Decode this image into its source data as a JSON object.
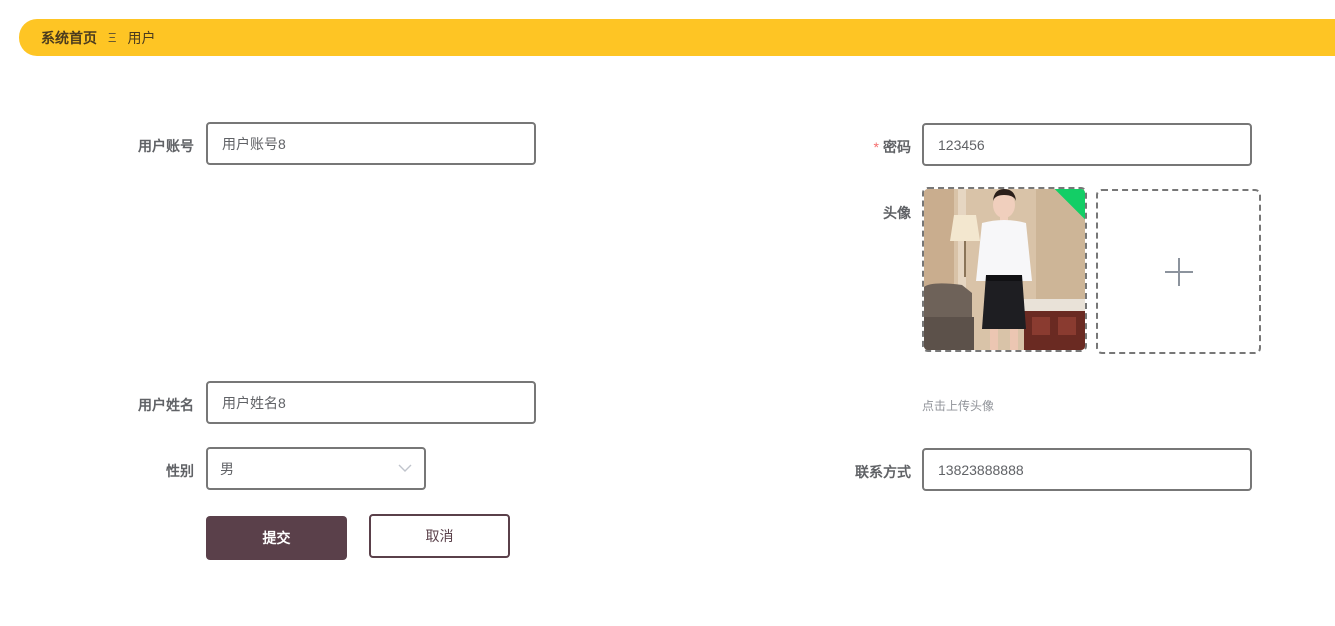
{
  "breadcrumb": {
    "home": "系统首页",
    "separator_icon": "menu-icon",
    "separator_glyph": "Ξ",
    "current": "用户"
  },
  "form": {
    "account": {
      "label": "用户账号",
      "value": "用户账号8"
    },
    "password": {
      "label": "密码",
      "required_mark": "*",
      "value": "123456"
    },
    "avatar": {
      "label": "头像",
      "hint": "点击上传头像",
      "upload_status": "success",
      "add_icon": "plus-icon"
    },
    "name": {
      "label": "用户姓名",
      "value": "用户姓名8"
    },
    "gender": {
      "label": "性别",
      "value": "男",
      "chevron_icon": "chevron-down-icon"
    },
    "phone": {
      "label": "联系方式",
      "value": "13823888888"
    }
  },
  "actions": {
    "submit_label": "提交",
    "cancel_label": "取消"
  },
  "colors": {
    "breadcrumb_bg": "#fec524",
    "primary": "#5a404a",
    "required": "#f56c6c",
    "success": "#13ce66"
  }
}
